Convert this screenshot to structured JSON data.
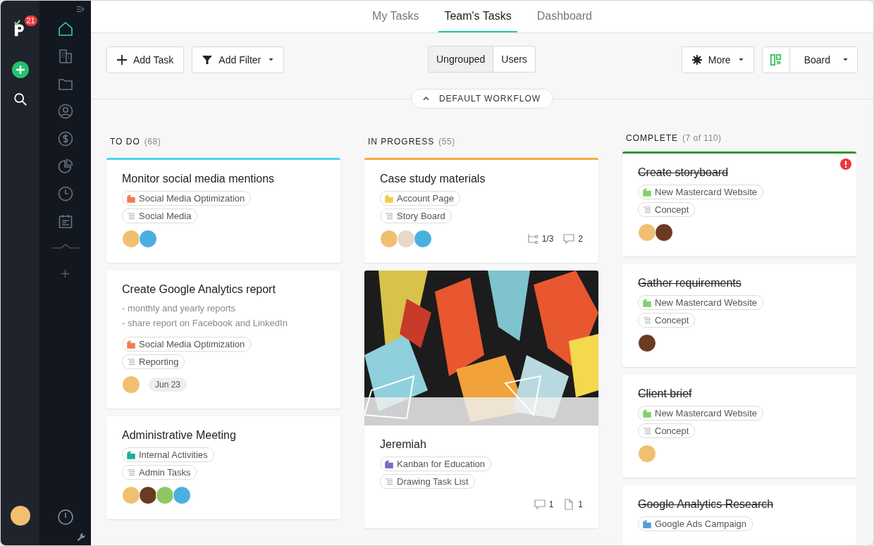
{
  "rail": {
    "logo_badge": "21",
    "user_avatar": {
      "color": "#f0c070"
    }
  },
  "nav": [
    {
      "kind": "home",
      "selected": true
    },
    {
      "kind": "building",
      "selected": false
    },
    {
      "kind": "folder",
      "selected": false
    },
    {
      "kind": "person",
      "selected": false
    },
    {
      "kind": "dollar",
      "selected": false
    },
    {
      "kind": "pie",
      "selected": false
    },
    {
      "kind": "clock",
      "selected": false
    },
    {
      "kind": "calendar",
      "selected": false
    }
  ],
  "tabs": [
    {
      "label": "My Tasks",
      "selected": false
    },
    {
      "label": "Team's Tasks",
      "selected": true
    },
    {
      "label": "Dashboard",
      "selected": false
    }
  ],
  "toolbar": {
    "add_task": "Add Task",
    "add_filter": "Add Filter",
    "grouping": [
      {
        "label": "Ungrouped",
        "selected": true
      },
      {
        "label": "Users",
        "selected": false
      }
    ],
    "more": "More",
    "view": "Board"
  },
  "workflow": "DEFAULT WORKFLOW",
  "columns": [
    {
      "name": "TO DO",
      "count": "(68)",
      "color": "#4dd4f2",
      "cards": [
        {
          "title": "Monitor social media mentions",
          "done": false,
          "alert": false,
          "tags": [
            {
              "kind": "project",
              "label": "Social Media Optimization",
              "color": "#f47b50"
            },
            {
              "kind": "list",
              "label": "Social Media"
            }
          ],
          "avatars": [
            {
              "color": "#f0c070"
            },
            {
              "color": "#4ab0e0"
            }
          ]
        },
        {
          "title": "Create Google Analytics report",
          "done": false,
          "alert": false,
          "notes": [
            "- monthly and yearly reports",
            "- share report on Facebook and LinkedIn"
          ],
          "tags": [
            {
              "kind": "project",
              "label": "Social Media Optimization",
              "color": "#f47b50"
            },
            {
              "kind": "list",
              "label": "Reporting"
            }
          ],
          "avatars": [
            {
              "color": "#f0c070"
            }
          ],
          "date": "Jun 23"
        },
        {
          "title": "Administrative Meeting",
          "done": false,
          "alert": false,
          "tags": [
            {
              "kind": "project",
              "label": "Internal Activities",
              "color": "#19b394"
            },
            {
              "kind": "list",
              "label": "Admin Tasks"
            }
          ],
          "avatars": [
            {
              "color": "#f0c070"
            },
            {
              "color": "#6b3a20"
            },
            {
              "color": "#8cc860"
            },
            {
              "color": "#4ab0e0"
            }
          ]
        }
      ]
    },
    {
      "name": "IN PROGRESS",
      "count": "(55)",
      "color": "#f7aa3c",
      "cards": [
        {
          "title": "Case study materials",
          "done": false,
          "alert": false,
          "tags": [
            {
              "kind": "project",
              "label": "Account Page",
              "color": "#f5cc44"
            },
            {
              "kind": "list",
              "label": "Story Board"
            }
          ],
          "avatars": [
            {
              "color": "#f0c070"
            },
            {
              "color": "#e8d8c8"
            },
            {
              "color": "#4ab0e0"
            }
          ],
          "meta": [
            {
              "kind": "subtasks",
              "text": "1/3"
            },
            {
              "kind": "comments",
              "text": "2"
            }
          ]
        },
        {
          "cover": {
            "kind": "picture"
          },
          "title": "Jeremiah",
          "done": false,
          "alert": false,
          "tags": [
            {
              "kind": "project",
              "label": "Kanban for Education",
              "color": "#7b68c8"
            },
            {
              "kind": "list",
              "label": "Drawing Task List"
            }
          ],
          "meta": [
            {
              "kind": "comments",
              "text": "1"
            },
            {
              "kind": "files",
              "text": "1"
            }
          ]
        }
      ]
    },
    {
      "name": "COMPLETE",
      "count": "(7 of 110)",
      "color": "#2e962e",
      "cards": [
        {
          "title": "Create storyboard",
          "done": true,
          "alert": true,
          "tags": [
            {
              "kind": "project",
              "label": "New Mastercard Website",
              "color": "#7fd36a"
            },
            {
              "kind": "list",
              "label": "Concept"
            }
          ],
          "avatars": [
            {
              "color": "#f0c070"
            },
            {
              "color": "#6b3a20"
            }
          ]
        },
        {
          "title": "Gather requirements",
          "done": true,
          "alert": false,
          "tags": [
            {
              "kind": "project",
              "label": "New Mastercard Website",
              "color": "#7fd36a"
            },
            {
              "kind": "list",
              "label": "Concept"
            }
          ],
          "avatars": [
            {
              "color": "#6b3a20"
            }
          ]
        },
        {
          "title": "Client brief",
          "done": true,
          "alert": false,
          "tags": [
            {
              "kind": "project",
              "label": "New Mastercard Website",
              "color": "#7fd36a"
            },
            {
              "kind": "list",
              "label": "Concept"
            }
          ],
          "avatars": [
            {
              "color": "#f0c070"
            }
          ]
        },
        {
          "title": "Google Analytics Research",
          "done": true,
          "alert": false,
          "tags": [
            {
              "kind": "project",
              "label": "Google Ads Campaign",
              "color": "#4a9ee0"
            }
          ]
        }
      ]
    }
  ]
}
